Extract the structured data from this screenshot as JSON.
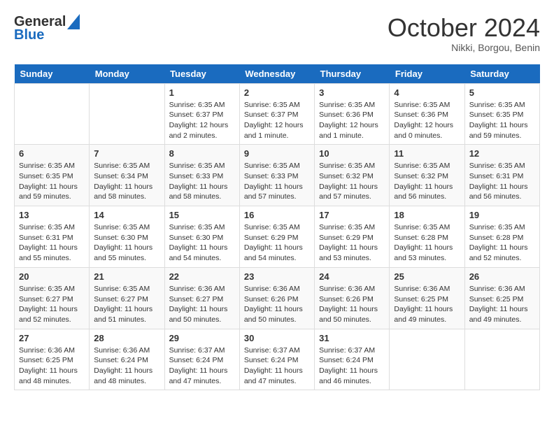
{
  "header": {
    "logo_line1": "General",
    "logo_line2": "Blue",
    "month_title": "October 2024",
    "location": "Nikki, Borgou, Benin"
  },
  "days_of_week": [
    "Sunday",
    "Monday",
    "Tuesday",
    "Wednesday",
    "Thursday",
    "Friday",
    "Saturday"
  ],
  "weeks": [
    [
      {
        "day": "",
        "detail": ""
      },
      {
        "day": "",
        "detail": ""
      },
      {
        "day": "1",
        "detail": "Sunrise: 6:35 AM\nSunset: 6:37 PM\nDaylight: 12 hours\nand 2 minutes."
      },
      {
        "day": "2",
        "detail": "Sunrise: 6:35 AM\nSunset: 6:37 PM\nDaylight: 12 hours\nand 1 minute."
      },
      {
        "day": "3",
        "detail": "Sunrise: 6:35 AM\nSunset: 6:36 PM\nDaylight: 12 hours\nand 1 minute."
      },
      {
        "day": "4",
        "detail": "Sunrise: 6:35 AM\nSunset: 6:36 PM\nDaylight: 12 hours\nand 0 minutes."
      },
      {
        "day": "5",
        "detail": "Sunrise: 6:35 AM\nSunset: 6:35 PM\nDaylight: 11 hours\nand 59 minutes."
      }
    ],
    [
      {
        "day": "6",
        "detail": "Sunrise: 6:35 AM\nSunset: 6:35 PM\nDaylight: 11 hours\nand 59 minutes."
      },
      {
        "day": "7",
        "detail": "Sunrise: 6:35 AM\nSunset: 6:34 PM\nDaylight: 11 hours\nand 58 minutes."
      },
      {
        "day": "8",
        "detail": "Sunrise: 6:35 AM\nSunset: 6:33 PM\nDaylight: 11 hours\nand 58 minutes."
      },
      {
        "day": "9",
        "detail": "Sunrise: 6:35 AM\nSunset: 6:33 PM\nDaylight: 11 hours\nand 57 minutes."
      },
      {
        "day": "10",
        "detail": "Sunrise: 6:35 AM\nSunset: 6:32 PM\nDaylight: 11 hours\nand 57 minutes."
      },
      {
        "day": "11",
        "detail": "Sunrise: 6:35 AM\nSunset: 6:32 PM\nDaylight: 11 hours\nand 56 minutes."
      },
      {
        "day": "12",
        "detail": "Sunrise: 6:35 AM\nSunset: 6:31 PM\nDaylight: 11 hours\nand 56 minutes."
      }
    ],
    [
      {
        "day": "13",
        "detail": "Sunrise: 6:35 AM\nSunset: 6:31 PM\nDaylight: 11 hours\nand 55 minutes."
      },
      {
        "day": "14",
        "detail": "Sunrise: 6:35 AM\nSunset: 6:30 PM\nDaylight: 11 hours\nand 55 minutes."
      },
      {
        "day": "15",
        "detail": "Sunrise: 6:35 AM\nSunset: 6:30 PM\nDaylight: 11 hours\nand 54 minutes."
      },
      {
        "day": "16",
        "detail": "Sunrise: 6:35 AM\nSunset: 6:29 PM\nDaylight: 11 hours\nand 54 minutes."
      },
      {
        "day": "17",
        "detail": "Sunrise: 6:35 AM\nSunset: 6:29 PM\nDaylight: 11 hours\nand 53 minutes."
      },
      {
        "day": "18",
        "detail": "Sunrise: 6:35 AM\nSunset: 6:28 PM\nDaylight: 11 hours\nand 53 minutes."
      },
      {
        "day": "19",
        "detail": "Sunrise: 6:35 AM\nSunset: 6:28 PM\nDaylight: 11 hours\nand 52 minutes."
      }
    ],
    [
      {
        "day": "20",
        "detail": "Sunrise: 6:35 AM\nSunset: 6:27 PM\nDaylight: 11 hours\nand 52 minutes."
      },
      {
        "day": "21",
        "detail": "Sunrise: 6:35 AM\nSunset: 6:27 PM\nDaylight: 11 hours\nand 51 minutes."
      },
      {
        "day": "22",
        "detail": "Sunrise: 6:36 AM\nSunset: 6:27 PM\nDaylight: 11 hours\nand 50 minutes."
      },
      {
        "day": "23",
        "detail": "Sunrise: 6:36 AM\nSunset: 6:26 PM\nDaylight: 11 hours\nand 50 minutes."
      },
      {
        "day": "24",
        "detail": "Sunrise: 6:36 AM\nSunset: 6:26 PM\nDaylight: 11 hours\nand 50 minutes."
      },
      {
        "day": "25",
        "detail": "Sunrise: 6:36 AM\nSunset: 6:25 PM\nDaylight: 11 hours\nand 49 minutes."
      },
      {
        "day": "26",
        "detail": "Sunrise: 6:36 AM\nSunset: 6:25 PM\nDaylight: 11 hours\nand 49 minutes."
      }
    ],
    [
      {
        "day": "27",
        "detail": "Sunrise: 6:36 AM\nSunset: 6:25 PM\nDaylight: 11 hours\nand 48 minutes."
      },
      {
        "day": "28",
        "detail": "Sunrise: 6:36 AM\nSunset: 6:24 PM\nDaylight: 11 hours\nand 48 minutes."
      },
      {
        "day": "29",
        "detail": "Sunrise: 6:37 AM\nSunset: 6:24 PM\nDaylight: 11 hours\nand 47 minutes."
      },
      {
        "day": "30",
        "detail": "Sunrise: 6:37 AM\nSunset: 6:24 PM\nDaylight: 11 hours\nand 47 minutes."
      },
      {
        "day": "31",
        "detail": "Sunrise: 6:37 AM\nSunset: 6:24 PM\nDaylight: 11 hours\nand 46 minutes."
      },
      {
        "day": "",
        "detail": ""
      },
      {
        "day": "",
        "detail": ""
      }
    ]
  ]
}
